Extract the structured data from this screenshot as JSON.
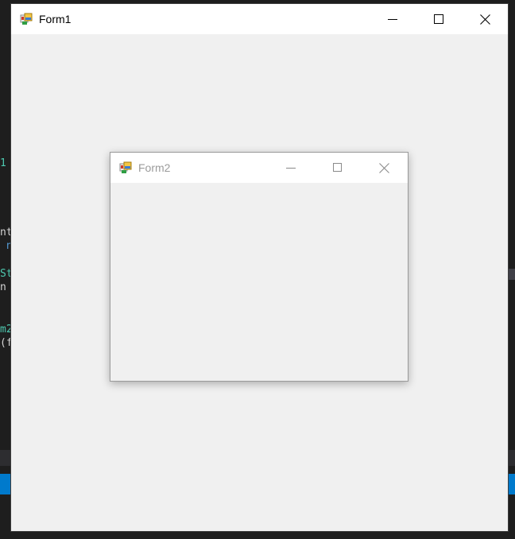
{
  "background_ide": {
    "fragments": [
      {
        "text": "1",
        "kind": "teal"
      },
      {
        "text": "nt",
        "kind": "plain"
      },
      {
        "text": " n",
        "kind": "blue"
      },
      {
        "text": "St",
        "kind": "teal"
      },
      {
        "text": "n",
        "kind": "plain"
      },
      {
        "text": "m2",
        "kind": "teal"
      },
      {
        "text": "(f",
        "kind": "plain"
      }
    ]
  },
  "form1": {
    "title": "Form1",
    "icon": "winforms-app-icon",
    "buttons": {
      "minimize": "minimize-icon",
      "maximize": "maximize-icon",
      "close": "close-icon"
    }
  },
  "form2": {
    "title": "Form2",
    "icon": "winforms-app-icon",
    "state": "inactive",
    "buttons": {
      "minimize": "minimize-icon",
      "maximize": "maximize-icon",
      "close": "close-icon"
    }
  },
  "colors": {
    "client_bg": "#f0f0f0",
    "titlebar_bg": "#ffffff",
    "inactive_title": "#9b9b9b",
    "ide_bg": "#1e1e1e",
    "ide_status_blue": "#007acc"
  }
}
